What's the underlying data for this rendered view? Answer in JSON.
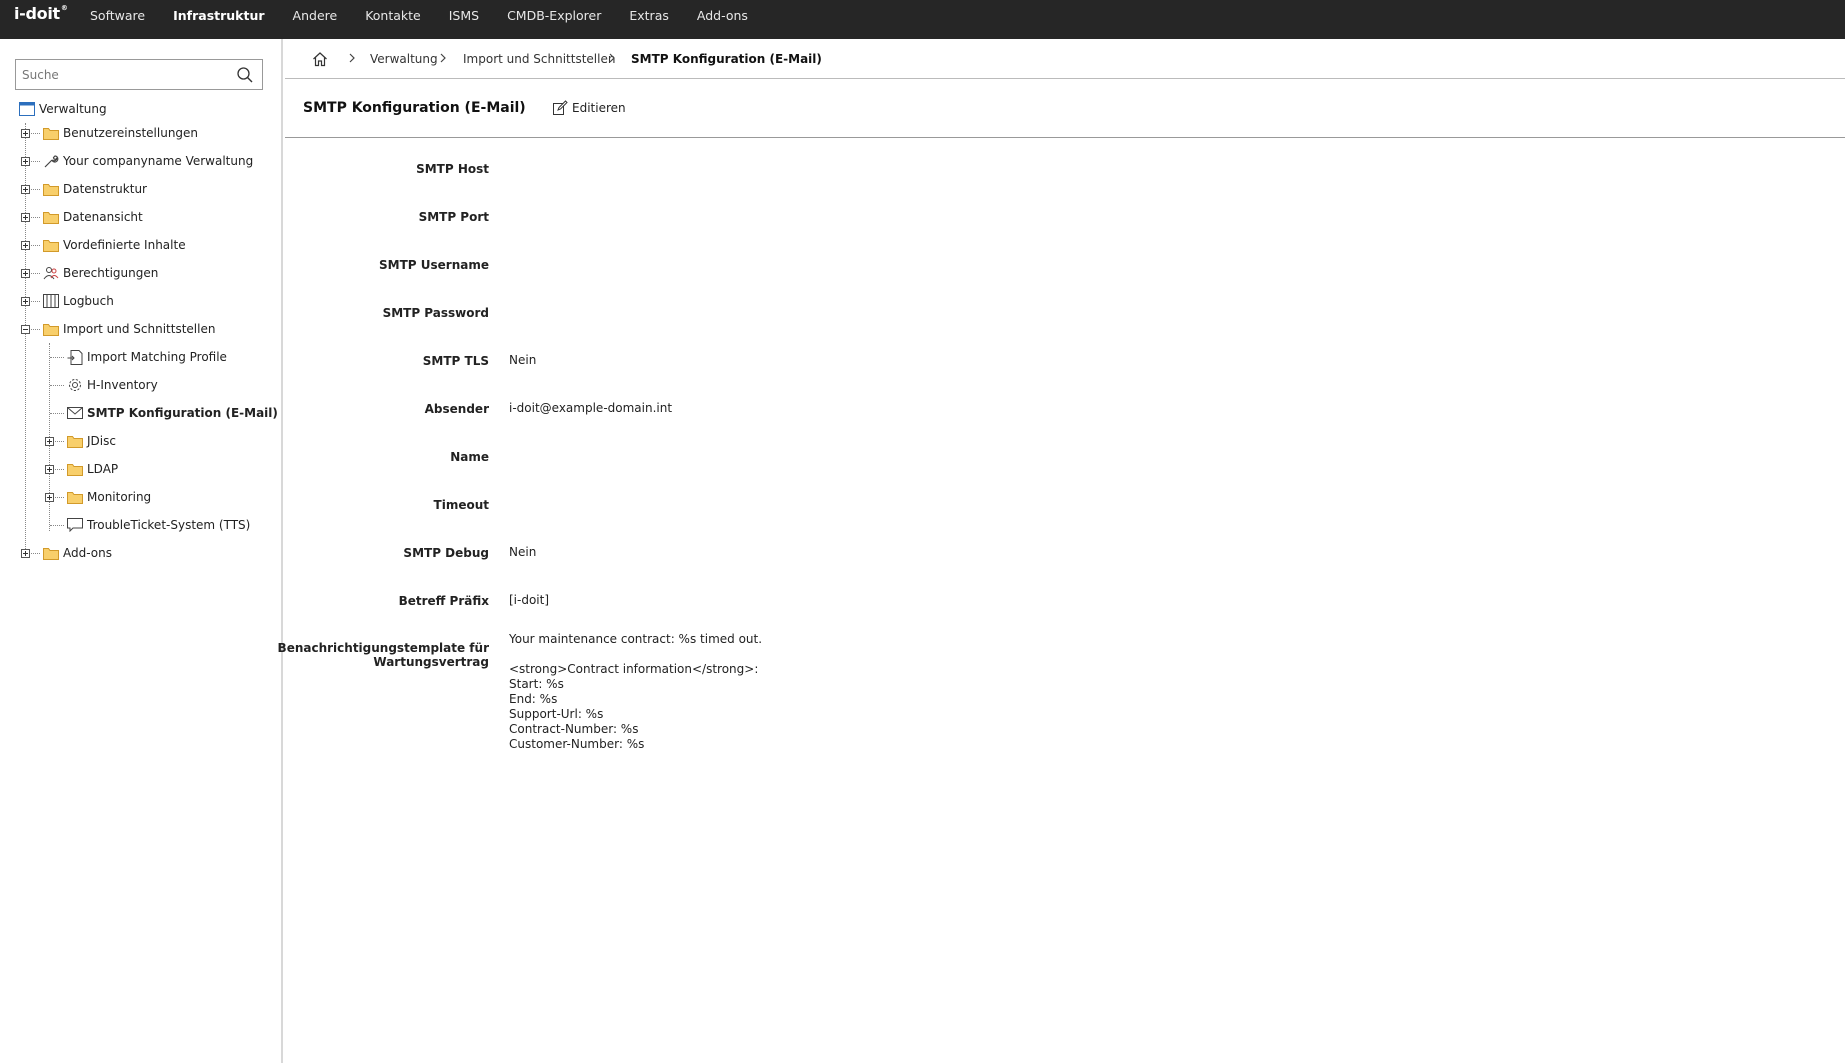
{
  "app": {
    "logo": "i-doit"
  },
  "nav": {
    "items": [
      {
        "label": "Software",
        "active": false
      },
      {
        "label": "Infrastruktur",
        "active": true
      },
      {
        "label": "Andere",
        "active": false
      },
      {
        "label": "Kontakte",
        "active": false
      },
      {
        "label": "ISMS",
        "active": false
      },
      {
        "label": "CMDB-Explorer",
        "active": false
      },
      {
        "label": "Extras",
        "active": false
      },
      {
        "label": "Add-ons",
        "active": false
      }
    ]
  },
  "sidebar": {
    "search": {
      "placeholder": "Suche",
      "value": ""
    },
    "tree": {
      "root": {
        "label": "Verwaltung",
        "icon": "window-icon"
      },
      "items": [
        {
          "label": "Benutzereinstellungen",
          "icon": "folder-icon"
        },
        {
          "label": "Your companyname Verwaltung",
          "icon": "wrench-icon"
        },
        {
          "label": "Datenstruktur",
          "icon": "folder-icon"
        },
        {
          "label": "Datenansicht",
          "icon": "folder-icon"
        },
        {
          "label": "Vordefinierte Inhalte",
          "icon": "folder-icon"
        },
        {
          "label": "Berechtigungen",
          "icon": "users-icon"
        },
        {
          "label": "Logbuch",
          "icon": "book-icon"
        },
        {
          "label": "Import und Schnittstellen",
          "icon": "folder-icon"
        },
        {
          "label": "Import Matching Profile",
          "icon": "file-import-icon"
        },
        {
          "label": "H-Inventory",
          "icon": "gear-icon"
        },
        {
          "label": "SMTP Konfiguration (E-Mail)",
          "icon": "mail-icon"
        },
        {
          "label": "JDisc",
          "icon": "folder-icon"
        },
        {
          "label": "LDAP",
          "icon": "folder-icon"
        },
        {
          "label": "Monitoring",
          "icon": "folder-icon"
        },
        {
          "label": "TroubleTicket-System (TTS)",
          "icon": "chat-icon"
        },
        {
          "label": "Add-ons",
          "icon": "folder-icon"
        }
      ]
    }
  },
  "breadcrumb": {
    "items": [
      "Verwaltung",
      "Import und Schnittstellen"
    ],
    "current": "SMTP Konfiguration (E-Mail)"
  },
  "page": {
    "title": "SMTP Konfiguration (E-Mail)",
    "edit_label": "Editieren"
  },
  "fields": [
    {
      "label": "SMTP Host",
      "value": ""
    },
    {
      "label": "SMTP Port",
      "value": ""
    },
    {
      "label": "SMTP Username",
      "value": ""
    },
    {
      "label": "SMTP Password",
      "value": ""
    },
    {
      "label": "SMTP TLS",
      "value": "Nein"
    },
    {
      "label": "Absender",
      "value": "i-doit@example-domain.int"
    },
    {
      "label": "Name",
      "value": ""
    },
    {
      "label": "Timeout",
      "value": ""
    },
    {
      "label": "SMTP Debug",
      "value": "Nein"
    },
    {
      "label": "Betreff Präfix",
      "value": "[i-doit]"
    }
  ],
  "template_field": {
    "label_line1": "Benachrichtigungstemplate für",
    "label_line2": "Wartungsvertrag",
    "value": "Your maintenance contract: %s timed out.\n\n<strong>Contract information</strong>:\nStart: %s\nEnd: %s\nSupport-Url: %s\nContract-Number: %s\nCustomer-Number: %s"
  }
}
